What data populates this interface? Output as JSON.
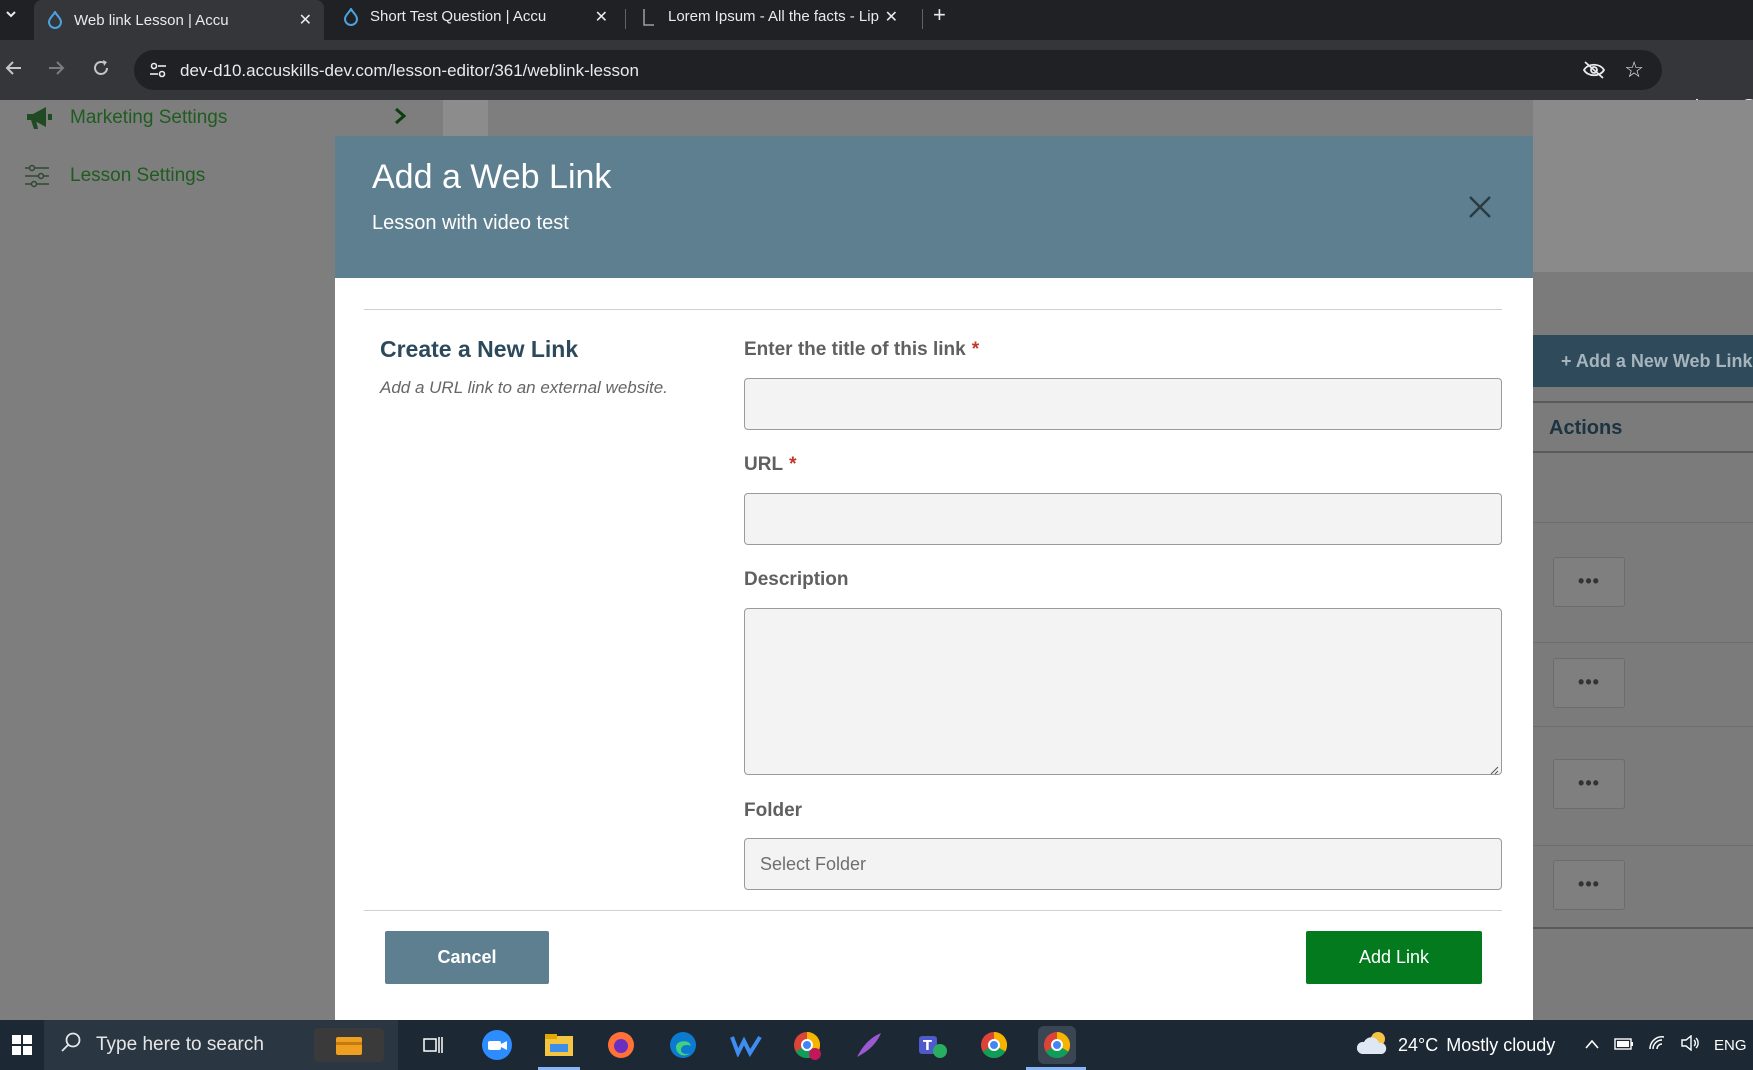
{
  "browser": {
    "tabs": [
      {
        "title": "Web link Lesson | Accu",
        "active": true
      },
      {
        "title": "Short Test Question | Accu",
        "active": false
      },
      {
        "title": "Lorem Ipsum - All the facts - Lip",
        "active": false
      }
    ],
    "url": "dev-d10.accuskills-dev.com/lesson-editor/361/weblink-lesson",
    "new_tab": "+",
    "close_glyph": "✕"
  },
  "sidebar": {
    "items": [
      {
        "label": "Marketing Settings",
        "icon": "megaphone-icon"
      },
      {
        "label": "Lesson Settings",
        "icon": "sliders-icon"
      }
    ],
    "chevron": "›"
  },
  "background_panel": {
    "add_button": "+ Add a New Web Link",
    "actions_header": "Actions",
    "row_menu": "•••"
  },
  "modal": {
    "title": "Add a Web Link",
    "subtitle": "Lesson with video test",
    "section_title": "Create a New Link",
    "section_description": "Add a URL link to an external website.",
    "fields": {
      "title_label": "Enter the title of this link",
      "url_label": "URL",
      "description_label": "Description",
      "folder_label": "Folder",
      "required_mark": "*",
      "title_value": "",
      "url_value": "",
      "description_value": "",
      "folder_placeholder": "Select Folder"
    },
    "buttons": {
      "cancel": "Cancel",
      "add": "Add Link"
    },
    "colors": {
      "header": "#5d7f90",
      "add_button": "#047a1e",
      "section_title": "#2c4a5b"
    }
  },
  "taskbar": {
    "search_placeholder": "Type here to search",
    "weather": {
      "temp": "24°C",
      "condition": "Mostly cloudy"
    },
    "language": "ENG"
  }
}
